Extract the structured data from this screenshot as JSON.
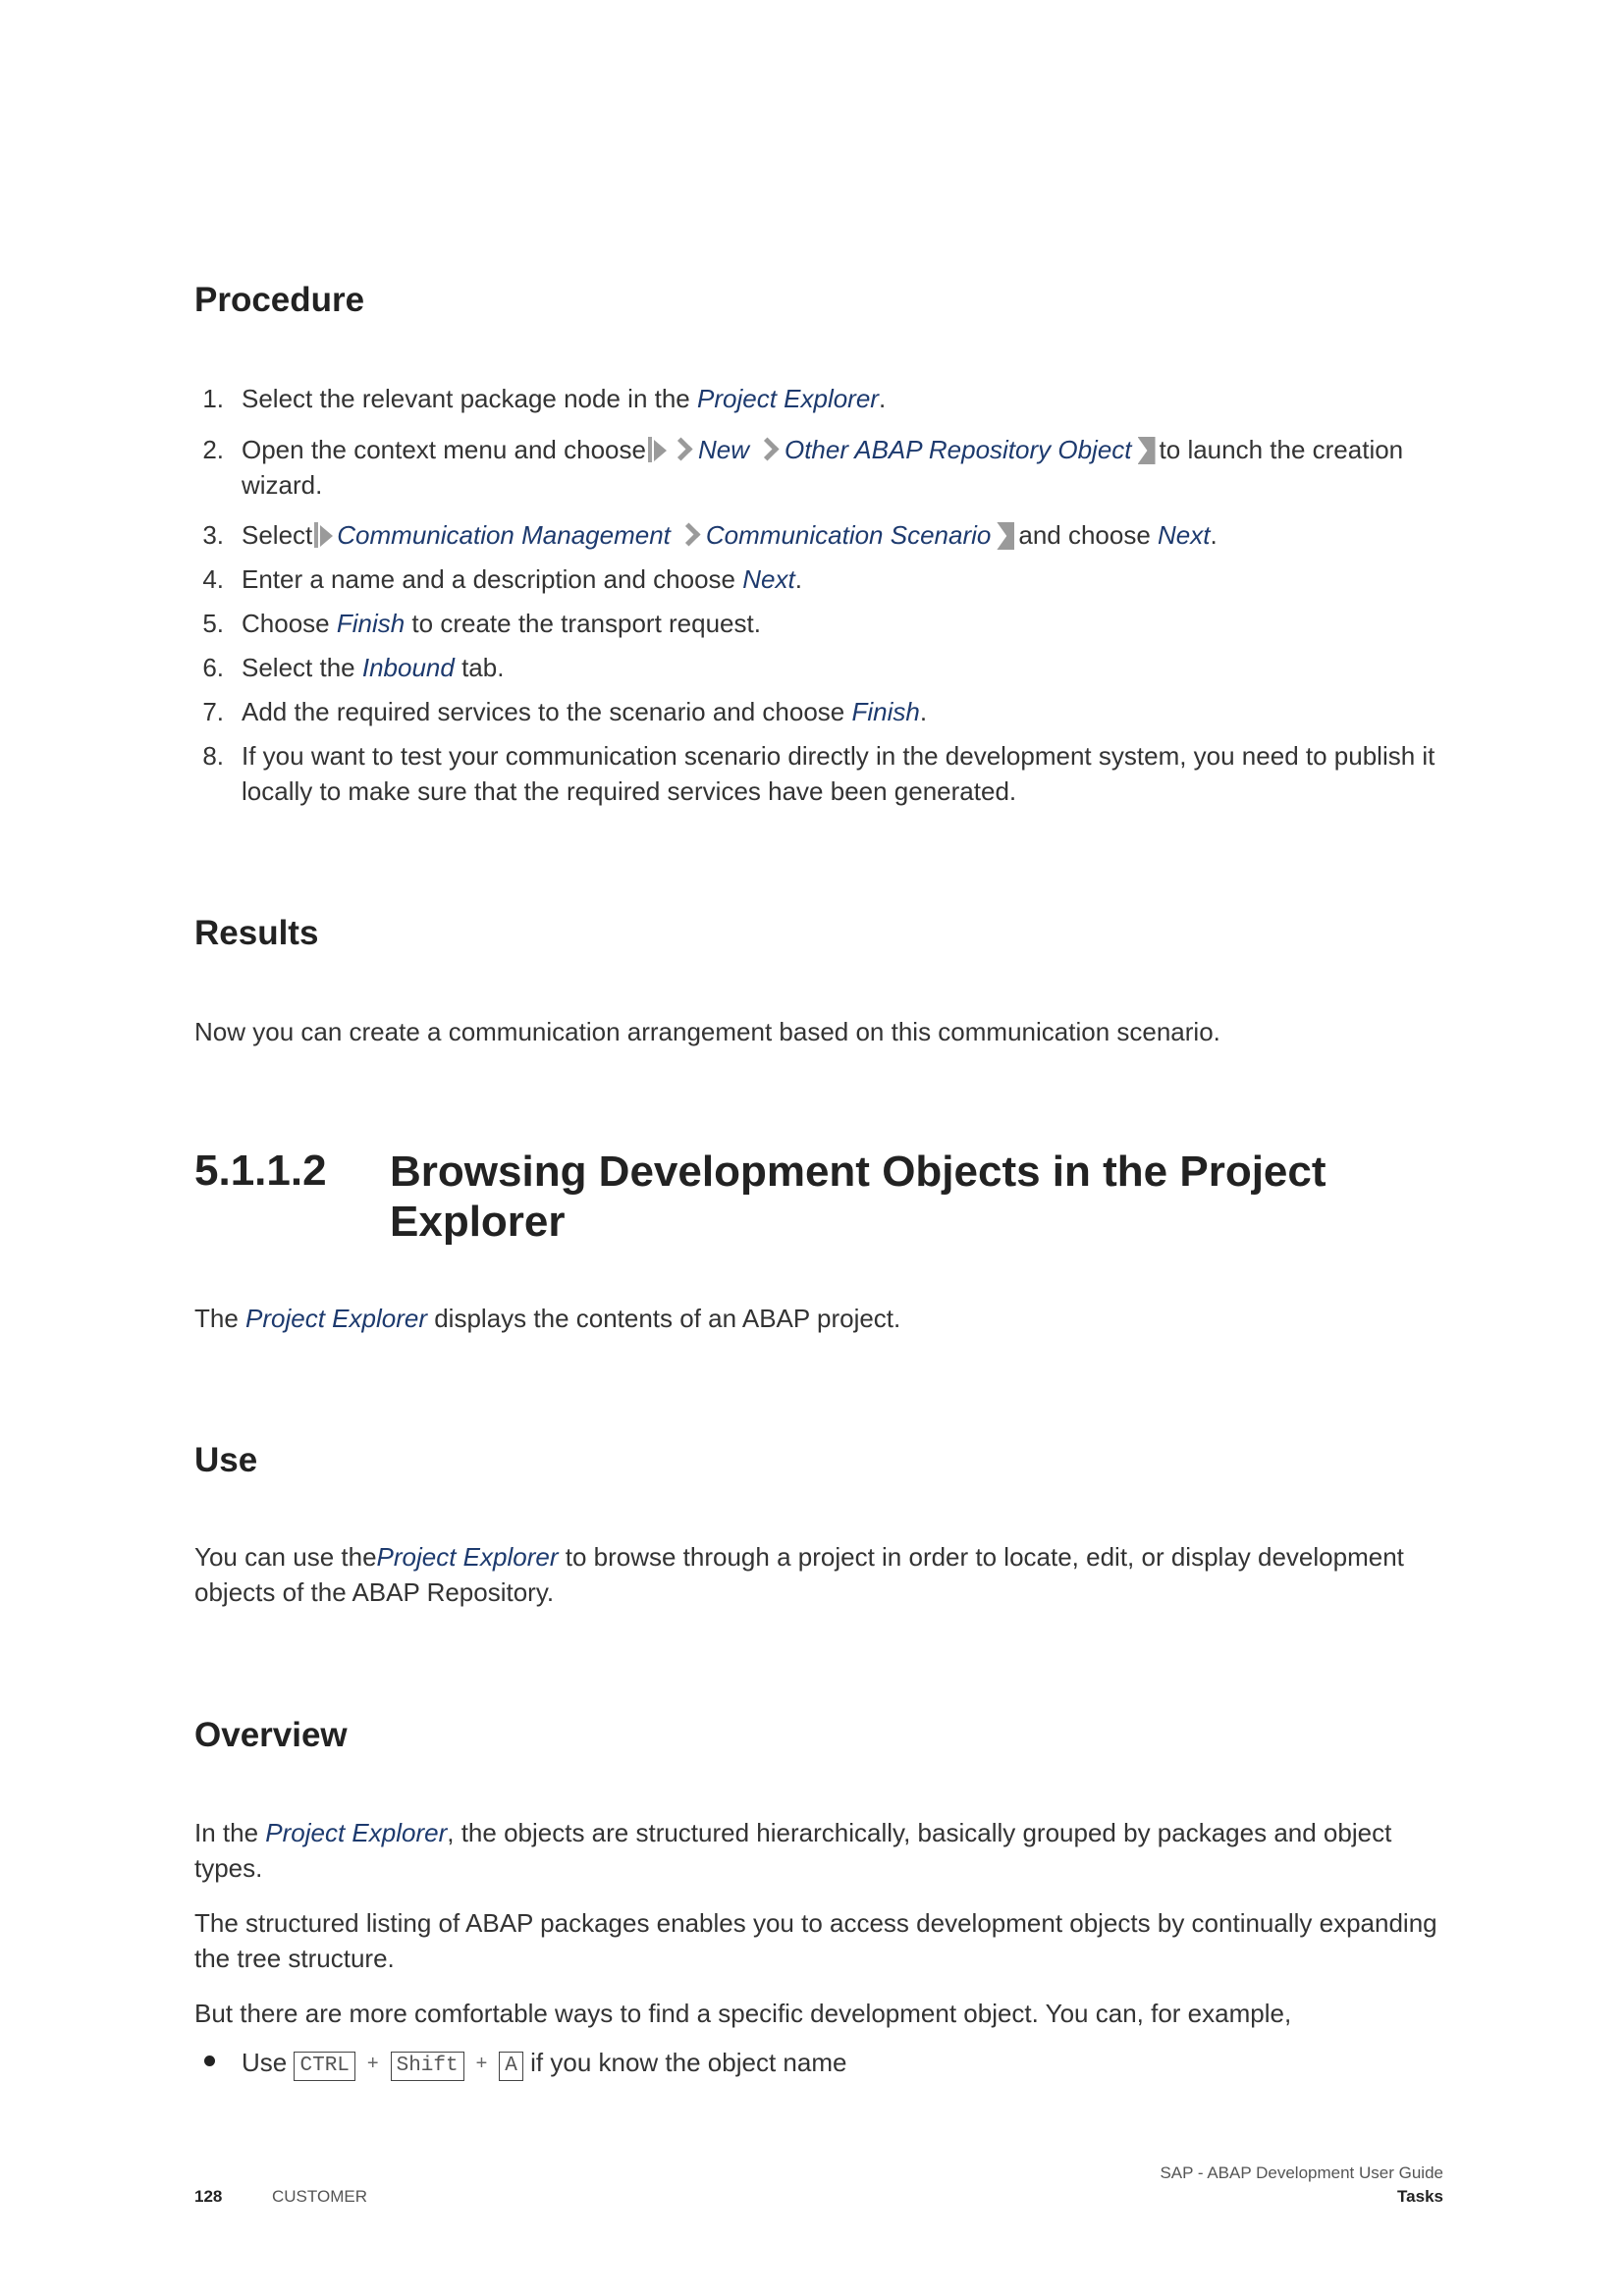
{
  "procedure": {
    "heading": "Procedure",
    "steps": [
      {
        "num": "1.",
        "a": "Select the relevant package node in the ",
        "link": "Project Explorer",
        "b": "."
      },
      {
        "num": "2.",
        "a": "Open the context menu and choose",
        "menu1": "New",
        "menu2": "Other ABAP Repository Object",
        "b": "to launch the creation",
        "c": "wizard."
      },
      {
        "num": "3.",
        "a": "Select",
        "menu1": "Communication Management",
        "menu2": "Communication Scenario",
        "b": "and choose ",
        "link": "Next",
        "c": "."
      },
      {
        "num": "4.",
        "a": "Enter a name and a description and choose ",
        "link": "Next",
        "b": "."
      },
      {
        "num": "5.",
        "a": "Choose ",
        "link": "Finish",
        "b": " to create the transport request."
      },
      {
        "num": "6.",
        "a": "Select the ",
        "link": "Inbound",
        "b": " tab."
      },
      {
        "num": "7.",
        "a": "Add the required services to the scenario and choose ",
        "link": "Finish",
        "b": "."
      },
      {
        "num": "8.",
        "a": "If you want to test your communication scenario directly in the development system, you need to publish it locally to make sure that the required services have been generated."
      }
    ]
  },
  "results": {
    "heading": "Results",
    "text": "Now you can create a communication arrangement based on this communication scenario."
  },
  "section": {
    "number": "5.1.1.2",
    "title_line1": "Browsing Development Objects in the Project",
    "title_line2": "Explorer",
    "intro_a": "The ",
    "intro_link": "Project Explorer",
    "intro_b": " displays the contents of an ABAP project."
  },
  "use": {
    "heading": "Use",
    "a": "You can use the",
    "link": "Project Explorer",
    "b": " to browse through a project in order to locate, edit, or display development",
    "c": "objects of the ABAP Repository."
  },
  "overview": {
    "heading": "Overview",
    "p1_a": "In the ",
    "p1_link": "Project Explorer",
    "p1_b": ", the objects are structured hierarchically, basically grouped by packages and object",
    "p1_c": "types.",
    "p2_a": "The structured listing of ABAP packages enables you to access development objects by continually expanding",
    "p2_b": "the tree structure.",
    "p3": "But there are more comfortable ways to find a specific development object. You can, for example,",
    "bullet_a": "Use",
    "key1": "CTRL",
    "key2": "Shift",
    "key3": "A",
    "plus": "+",
    "bullet_b": "if you know the object name"
  },
  "footer": {
    "page": "128",
    "label": "CUSTOMER",
    "doc_title": "SAP - ABAP Development User Guide",
    "chapter": "Tasks"
  }
}
